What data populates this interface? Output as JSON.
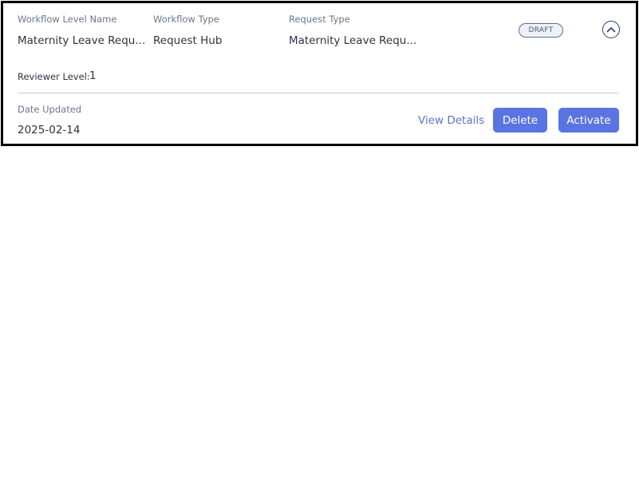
{
  "workflow": {
    "level_name_label": "Workflow Level Name",
    "level_name_value": "Maternity Leave Requ...",
    "type_label": "Workflow Type",
    "type_value": "Request Hub",
    "request_type_label": "Request Type",
    "request_type_value": "Maternity Leave Requ...",
    "status_badge": "DRAFT",
    "reviewer_level_label": "Reviewer Level:",
    "reviewer_level_value": "1",
    "date_updated_label": "Date Updated",
    "date_updated_value": "2025-02-14"
  },
  "actions": {
    "view_details_label": "View Details",
    "delete_label": "Delete",
    "activate_label": "Activate"
  },
  "icons": {
    "collapse": "chevron-up-icon"
  },
  "colors": {
    "primary_button": "#5a74e1",
    "link": "#5b73c8",
    "label_text": "#6b7789",
    "value_text": "#2d3441",
    "badge_border": "#5f6f8a"
  }
}
